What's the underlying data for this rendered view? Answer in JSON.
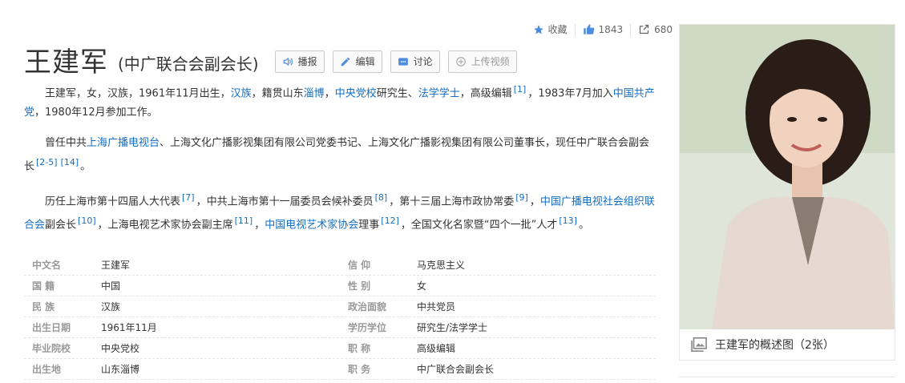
{
  "stats": {
    "collect_label": "收藏",
    "likes": "1843",
    "shares": "680"
  },
  "title": "王建军",
  "subtitle": "(中广联合会副会长)",
  "buttons": {
    "play": "播报",
    "edit": "编辑",
    "discuss": "讨论",
    "upload": "上传视频"
  },
  "para1": {
    "t1": "王建军，女，汉族，1961年11月出生，",
    "l_han": "汉族",
    "t2": "，籍贯山东",
    "l_zibo": "淄博",
    "t3": "，",
    "l_school": "中央党校",
    "t4": "研究生、",
    "l_degree": "法学学士",
    "t5": "，高级编辑",
    "r1": "[1]",
    "t6": "，1983年7月加入",
    "l_party": "中国共产党",
    "t7": "，1980年12月参加工作。"
  },
  "para2": {
    "t1": "曾任中共",
    "l_smg": "上海广播电视台",
    "t2": "、上海文化广播影视集团有限公司党委书记、上海文化广播影视集团有限公司董事长，现任中广联合会副会长",
    "r1": "[2-5]",
    "r2": "[14]",
    "t3": "。"
  },
  "para3": {
    "t1": "历任上海市第十四届人大代表",
    "r1": "[7]",
    "t2": "，中共上海市第十一届委员会候补委员",
    "r2": "[8]",
    "t3": "，第十三届上海市政协常委",
    "r3": "[9]",
    "t4": "，",
    "l_cfta": "中国广播电视社会组织联合会",
    "t5": "副会长",
    "r4": "[10]",
    "t6": "，上海电视艺术家协会副主席",
    "r5": "[11]",
    "t7": "，",
    "l_ctaa": "中国电视艺术家协会",
    "t8": "理事",
    "r6": "[12]",
    "t9": "，全国文化名家暨“四个一批”人才",
    "r7": "[13]",
    "t10": "。"
  },
  "info": {
    "rows": [
      {
        "ln": "中文名",
        "lv": "王建军",
        "rn": "信 仰",
        "rv": "马克思主义"
      },
      {
        "ln": "国 籍",
        "lv": "中国",
        "rn": "性 别",
        "rv": "女"
      },
      {
        "ln": "民 族",
        "lv": "汉族",
        "rn": "政治面貌",
        "rv": "中共党员"
      },
      {
        "ln": "出生日期",
        "lv": "1961年11月",
        "rn": "学历学位",
        "rv": "研究生/法学学士"
      },
      {
        "ln": "毕业院校",
        "lv": "中央党校",
        "rn": "职 称",
        "rv": "高级编辑"
      },
      {
        "ln": "出生地",
        "lv": "山东淄博",
        "rn": "职 务",
        "rv": "中广联合会副会长"
      }
    ]
  },
  "photo": {
    "caption": "王建军的概述图（2张）"
  },
  "colors": {
    "link": "#136ec2",
    "icon": "#4e8ce0"
  }
}
